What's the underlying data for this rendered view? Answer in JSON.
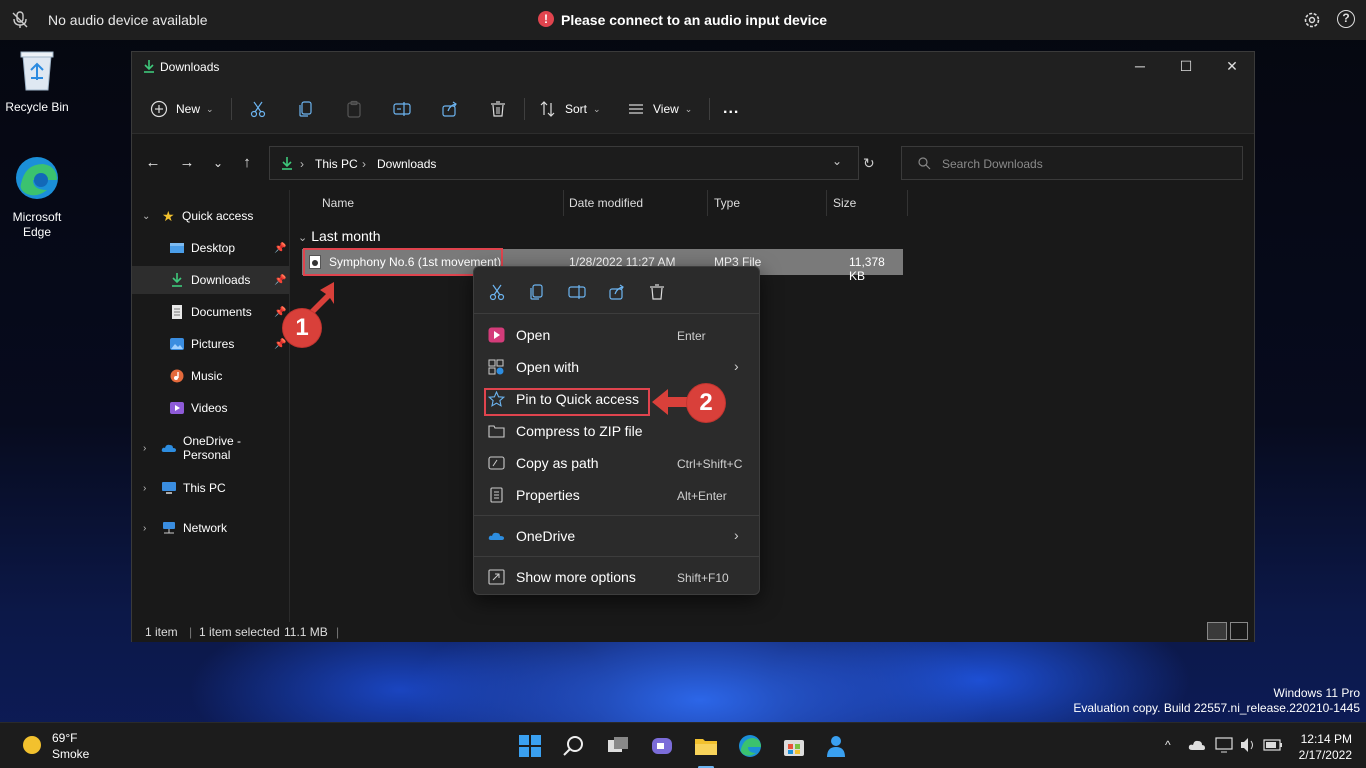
{
  "topbar": {
    "audio_status": "No audio device available",
    "warning": "Please connect to an audio input device"
  },
  "desktop_icons": [
    {
      "label": "Recycle Bin"
    },
    {
      "label": "Microsoft Edge"
    }
  ],
  "window": {
    "title": "Downloads",
    "toolbar": {
      "new_label": "New",
      "sort_label": "Sort",
      "view_label": "View",
      "more_label": "..."
    },
    "address": {
      "crumbs": [
        "This PC",
        "Downloads"
      ]
    },
    "search": {
      "placeholder": "Search Downloads"
    },
    "sidebar": {
      "quick_access": "Quick access",
      "items": [
        {
          "label": "Desktop"
        },
        {
          "label": "Downloads"
        },
        {
          "label": "Documents"
        },
        {
          "label": "Pictures"
        },
        {
          "label": "Music"
        },
        {
          "label": "Videos"
        }
      ],
      "onedrive": "OneDrive - Personal",
      "this_pc": "This PC",
      "network": "Network"
    },
    "columns": {
      "name": "Name",
      "date": "Date modified",
      "type": "Type",
      "size": "Size"
    },
    "group_label": "Last month",
    "file": {
      "name": "Symphony No.6 (1st movement)",
      "date": "1/28/2022 11:27 AM",
      "type": "MP3 File",
      "size": "11,378 KB"
    },
    "status": {
      "count": "1 item",
      "selected": "1 item selected",
      "size": "11.1 MB"
    }
  },
  "context_menu": {
    "items": [
      {
        "label": "Open",
        "shortcut": "Enter"
      },
      {
        "label": "Open with",
        "shortcut": ""
      },
      {
        "label": "Pin to Quick access",
        "shortcut": ""
      },
      {
        "label": "Compress to ZIP file",
        "shortcut": ""
      },
      {
        "label": "Copy as path",
        "shortcut": "Ctrl+Shift+C"
      },
      {
        "label": "Properties",
        "shortcut": "Alt+Enter"
      },
      {
        "label": "OneDrive",
        "shortcut": ""
      },
      {
        "label": "Show more options",
        "shortcut": "Shift+F10"
      }
    ]
  },
  "callouts": {
    "one": "1",
    "two": "2"
  },
  "watermark": {
    "line1": "Windows 11 Pro",
    "line2": "Evaluation copy. Build 22557.ni_release.220210-1445"
  },
  "taskbar": {
    "weather_temp": "69°F",
    "weather_desc": "Smoke",
    "time": "12:14 PM",
    "date": "2/17/2022"
  },
  "colors": {
    "accent_red": "#e0444e",
    "selected_row": "#7a7a7a",
    "window_bg": "#191919"
  }
}
